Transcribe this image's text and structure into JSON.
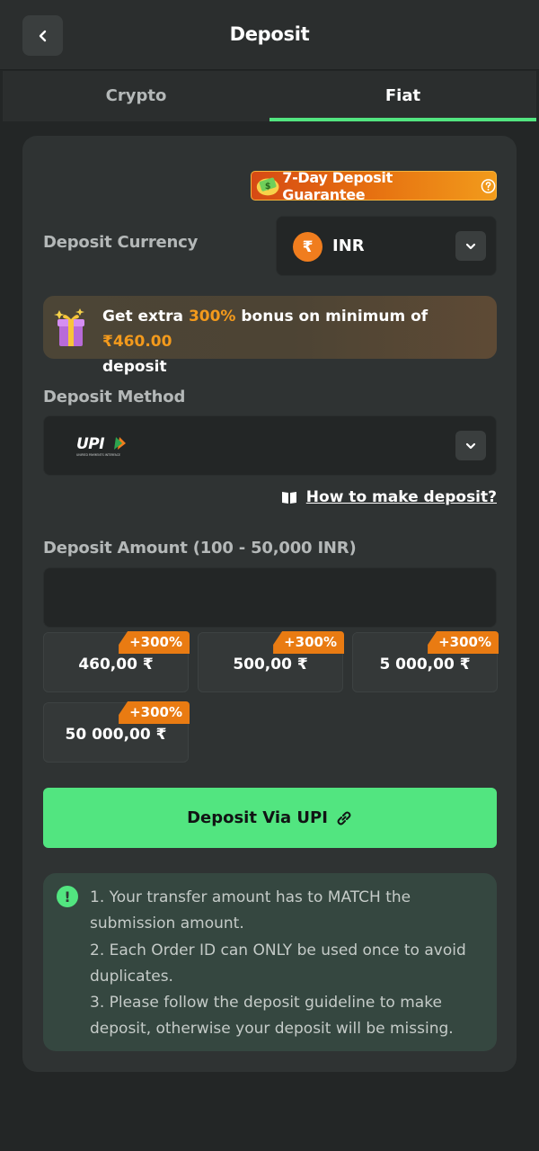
{
  "header": {
    "title": "Deposit"
  },
  "tabs": [
    {
      "label": "Crypto",
      "active": false
    },
    {
      "label": "Fiat",
      "active": true
    }
  ],
  "guarantee": {
    "label": "7-Day Deposit Guarantee"
  },
  "currency": {
    "label": "Deposit Currency",
    "symbol": "₹",
    "selected": "INR"
  },
  "bonus": {
    "prefix": "Get extra ",
    "percent": "300%",
    "middle": " bonus on minimum of ",
    "amount": "₹460.00",
    "suffix": "deposit"
  },
  "method": {
    "label": "Deposit Method",
    "selected_logo": "UPI",
    "selected_logo_subtitle": "UNIFIED PAYMENTS INTERFACE"
  },
  "howto": {
    "label": "How to make deposit?"
  },
  "amount": {
    "label": "Deposit Amount (100 - 50,000 INR)",
    "value": "",
    "placeholder": ""
  },
  "presets": [
    {
      "amount": "460,00 ₹",
      "badge": "+300%"
    },
    {
      "amount": "500,00 ₹",
      "badge": "+300%"
    },
    {
      "amount": "5 000,00 ₹",
      "badge": "+300%"
    },
    {
      "amount": "50 000,00 ₹",
      "badge": "+300%"
    }
  ],
  "submit": {
    "label": "Deposit Via UPI"
  },
  "notice": {
    "line1": "1. Your transfer amount has to MATCH the submission amount.",
    "line2": "2. Each Order ID can ONLY be used once to avoid duplicates.",
    "line3": "3. Please follow the deposit guideline to make deposit, otherwise your deposit will be missing."
  },
  "colors": {
    "accent": "#52e580",
    "orange": "#f39a1c",
    "background": "#232626",
    "card": "#2f3333"
  },
  "icons": {
    "back": "chevron-left-icon",
    "guarantee": "money-shield-icon",
    "help": "question-circle-icon",
    "currency": "rupee-coin-icon",
    "dropdown": "chevron-down-icon",
    "gift": "gift-icon",
    "book": "book-icon",
    "link": "link-icon",
    "alert": "exclamation-circle-icon"
  }
}
